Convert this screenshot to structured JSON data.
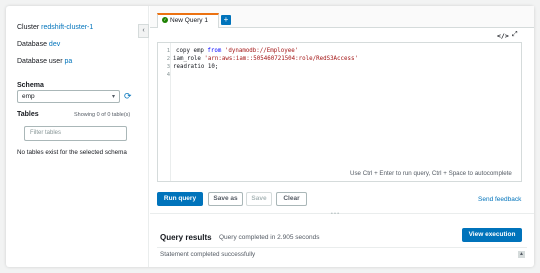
{
  "sidebar": {
    "cluster_label": "Cluster",
    "cluster_value": "redshift-cluster-1",
    "database_label": "Database",
    "database_value": "dev",
    "user_label": "Database user",
    "user_value": "pa",
    "schema_title": "Schema",
    "schema_selected": "emp",
    "tables_title": "Tables",
    "tables_count": "Showing 0 of 0 table(s)",
    "filter_placeholder": "Filter tables",
    "no_tables": "No tables exist for the selected schema",
    "collapse_glyph": "‹"
  },
  "tabs": {
    "active_label": "New Query 1",
    "add_glyph": "+"
  },
  "editor": {
    "line_numbers": [
      "1",
      "2",
      "3",
      "4"
    ],
    "line1_a": "copy emp ",
    "line1_kw": "from",
    "line1_str": " 'dynamodb://Employee'",
    "line2_a": "iam_role ",
    "line2_str": "'arn:aws:iam::505460721504:role/RedS3Access'",
    "line3": "readratio 10;",
    "hint": "Use Ctrl + Enter to run query, Ctrl + Space to autocomplete",
    "code_icon": "</>",
    "expand_icon": "⤢"
  },
  "actions": {
    "run": "Run query",
    "save_as": "Save as",
    "save": "Save",
    "clear": "Clear",
    "feedback": "Send feedback"
  },
  "results": {
    "title": "Query results",
    "subtitle": "Query completed in 2.905 seconds",
    "view_execution": "View execution",
    "status": "Statement completed successfully"
  },
  "colors": {
    "accent": "#0073bb",
    "tab_border": "#ec7211",
    "success": "#1d8102"
  }
}
